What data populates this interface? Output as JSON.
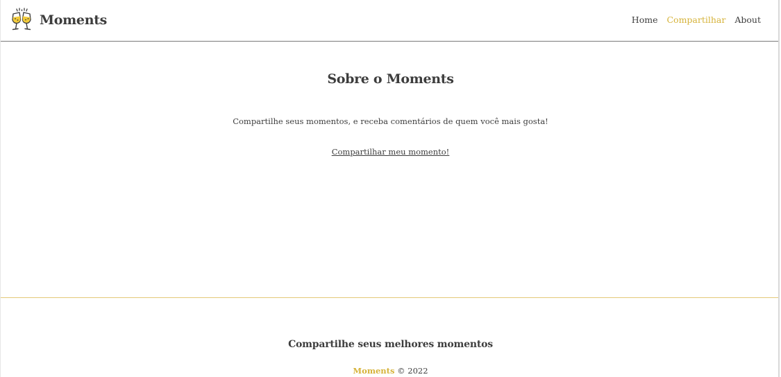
{
  "header": {
    "brand_name": "Moments",
    "logo_icon": "champagne-toast-icon",
    "nav": [
      {
        "label": "Home",
        "active": false
      },
      {
        "label": "Compartilhar",
        "active": true
      },
      {
        "label": "About",
        "active": false
      }
    ]
  },
  "main": {
    "title": "Sobre o Moments",
    "description": "Compartilhe seus momentos, e receba comentários de quem você mais gosta!",
    "cta_link": "Compartilhar meu momento!"
  },
  "footer": {
    "title": "Compartilhe seus melhores momentos",
    "brand": "Moments",
    "copyright": "© 2022"
  },
  "colors": {
    "accent": "#d6b33a",
    "text": "#3d3d3d",
    "header_border": "#7a7a7a",
    "footer_border": "#e3c878"
  }
}
